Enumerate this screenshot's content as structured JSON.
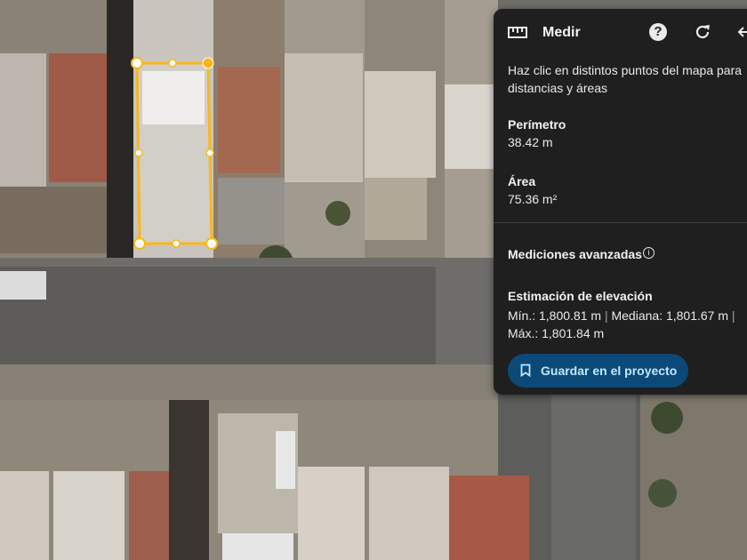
{
  "panel": {
    "title": "Medir",
    "hint": "Haz clic en distintos puntos del mapa para distancias y áreas",
    "perimeter": {
      "label": "Perímetro",
      "value": "38.42 m"
    },
    "area": {
      "label": "Área",
      "value": "75.36 m²"
    },
    "advanced_label": "Mediciones avanzadas",
    "info_icon": "i",
    "elevation": {
      "label": "Estimación de elevación",
      "min": "Mín.: 1,800.81 m",
      "median": "Mediana: 1,801.67 m",
      "max": "Máx.: 1,801.84 m",
      "separator": "|"
    },
    "save_button": "Guardar en el proyecto",
    "help_icon": "?"
  },
  "icons": [
    "ruler-icon",
    "help-icon",
    "refresh-icon",
    "back-icon",
    "info-icon",
    "bookmark-icon"
  ],
  "colors": {
    "panel_bg": "#1f1f1f",
    "measure": "#f9b71a",
    "save_bg": "#0b4a78",
    "save_text": "#c2e7ff"
  }
}
